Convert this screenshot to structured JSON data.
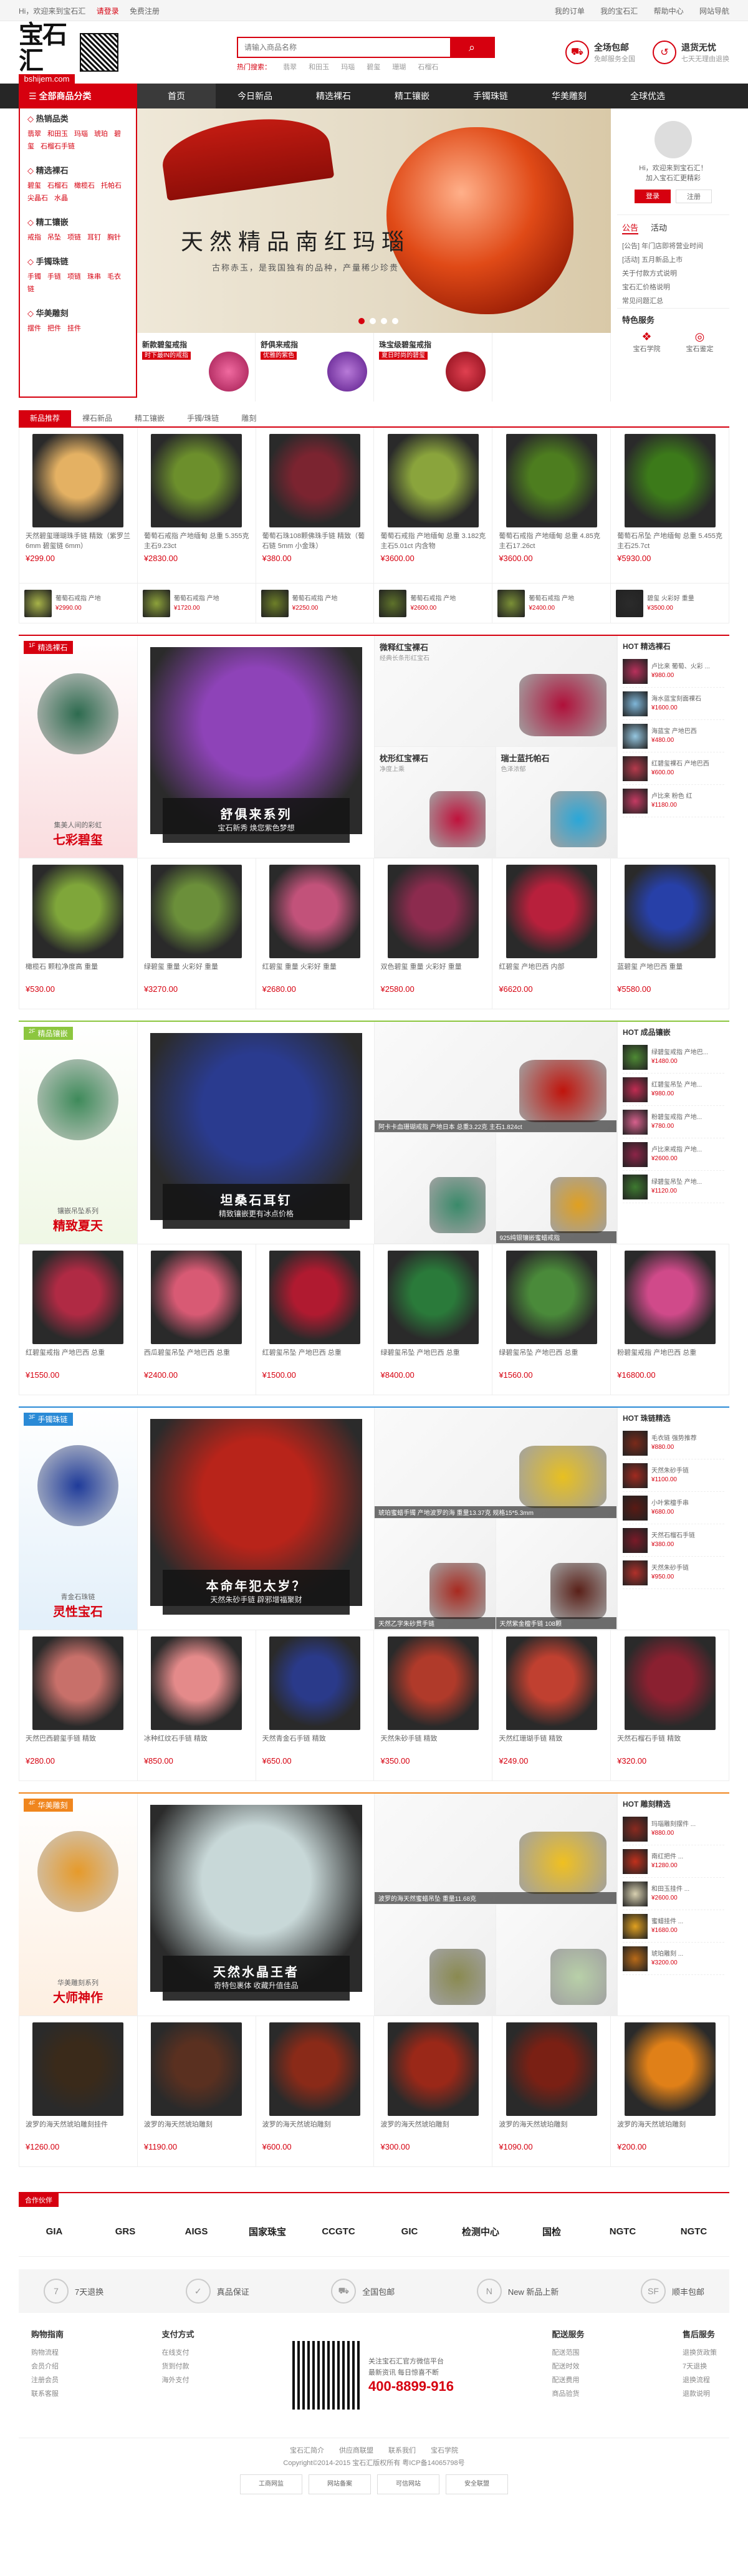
{
  "topbar": {
    "welcome": "Hi，欢迎来到宝石汇",
    "login": "请登录",
    "register": "免费注册",
    "my_orders": "我的订单",
    "my_account": "我的宝石汇",
    "help": "帮助中心",
    "sitemap": "网站导航"
  },
  "header": {
    "logo_text": "宝石汇",
    "logo_url": "bshijem.com",
    "search_placeholder": "请输入商品名称",
    "search_button": "⌕",
    "hot_words": [
      "热门搜索：",
      "翡翠",
      "和田玉",
      "玛瑙",
      "碧玺",
      "珊瑚",
      "石榴石"
    ],
    "promises": [
      {
        "title": "全场包邮",
        "sub": "免邮服务全国"
      },
      {
        "title": "退货无忧",
        "sub": "七天无理由退换"
      }
    ]
  },
  "nav": {
    "all_categories": "全部商品分类",
    "items": [
      "首页",
      "今日新品",
      "精选裸石",
      "精工镶嵌",
      "手镯珠链",
      "华美雕刻",
      "全球优选"
    ]
  },
  "categories": [
    {
      "title": "热销品类",
      "links": [
        "翡翠",
        "和田玉",
        "玛瑙",
        "琥珀",
        "碧玺",
        "石榴石手链"
      ]
    },
    {
      "title": "精选裸石",
      "links": [
        "碧玺",
        "石榴石",
        "橄榄石",
        "托帕石",
        "尖晶石",
        "水晶"
      ]
    },
    {
      "title": "精工镶嵌",
      "links": [
        "戒指",
        "吊坠",
        "项链",
        "耳钉",
        "胸针"
      ]
    },
    {
      "title": "手镯珠链",
      "links": [
        "手镯",
        "手链",
        "项链",
        "珠串",
        "毛衣链"
      ]
    },
    {
      "title": "华美雕刻",
      "links": [
        "摆件",
        "把件",
        "挂件"
      ]
    }
  ],
  "banner": {
    "headline": "天然精品南红玛瑙",
    "sub": "古称赤玉，是我国独有的品种，产量稀少珍贵"
  },
  "sub_banners": [
    {
      "title": "新款碧玺戒指",
      "tag": "时下最IN的戒指"
    },
    {
      "title": "舒俱来戒指",
      "tag": "优雅的紫色"
    },
    {
      "title": "珠宝级碧玺戒指",
      "tag": "夏日时尚的碧玺"
    }
  ],
  "side": {
    "greeting": "Hi，欢迎来到宝石汇！",
    "greeting2": "加入宝石汇更精彩",
    "login_btn": "登录",
    "register_btn": "注册",
    "tabs": [
      "公告",
      "活动"
    ],
    "news": [
      "[公告] 年门店即将营业时间",
      "[活动] 五月新品上市",
      "关于付款方式说明",
      "宝石汇价格说明",
      "常见问题汇总"
    ],
    "service_title": "特色服务",
    "services": [
      "宝石学院",
      "宝石鉴定"
    ]
  },
  "new_tabs": [
    "新品推荐",
    "裸石新品",
    "精工镶嵌",
    "手镯/珠链",
    "雕刻"
  ],
  "new_products": [
    {
      "title": "天然碧玺珊瑚珠手链 精致（紫罗兰 6mm 碧玺链 6mm）",
      "price": "¥299.00",
      "color": "#e4b163"
    },
    {
      "title": "葡萄石戒指 产地缅甸 总重 5.355克 主石9.23ct",
      "price": "¥2830.00",
      "color": "#6c8f2c"
    },
    {
      "title": "葡萄石珠108颗佛珠手链 精致（葡石链 5mm 小金珠）",
      "price": "¥380.00",
      "color": "#7b2430"
    },
    {
      "title": "葡萄石戒指 产地缅甸 总重 3.182克 主石5.01ct 内含物",
      "price": "¥3600.00",
      "color": "#8aa43c"
    },
    {
      "title": "葡萄石戒指 产地缅甸 总重 4.85克 主石17.26ct",
      "price": "¥3600.00",
      "color": "#4d7d1f"
    },
    {
      "title": "葡萄石吊坠 产地缅甸 总重 5.455克 主石25.7ct",
      "price": "¥5930.00",
      "color": "#3c7a1a"
    }
  ],
  "mini_products": [
    {
      "title": "葡萄石戒指 产地",
      "price": "¥2990.00",
      "color": "#a7b348"
    },
    {
      "title": "葡萄石戒指 产地",
      "price": "¥1720.00",
      "color": "#8ca13a"
    },
    {
      "title": "葡萄石戒指 产地",
      "price": "¥2250.00",
      "color": "#6d7f28"
    },
    {
      "title": "葡萄石戒指 产地",
      "price": "¥2600.00",
      "color": "#5e722a"
    },
    {
      "title": "葡萄石戒指 产地",
      "price": "¥2400.00",
      "color": "#7a8f36"
    },
    {
      "title": "碧玺 火彩好 重量",
      "price": "¥3500.00",
      "color": "#2b2b2b"
    }
  ],
  "floors": [
    {
      "num": "1F",
      "name": "精选裸石",
      "tag_color": "#d6000f",
      "promo_title": "七彩碧玺",
      "promo_sub": "集美人间的彩虹",
      "deco": "#2d6b4f",
      "main_title": "舒俱来系列",
      "main_sub": "宝石新秀 焕您紫色梦想",
      "main_color": "#8e43b8",
      "grid": [
        {
          "title": "微释红宝裸石",
          "sub": "经典长条形红宝石",
          "color": "#b0103a",
          "wide": true
        },
        {
          "title": "枕形红宝裸石",
          "sub": "净度上乘",
          "color": "#c0123c"
        },
        {
          "title": "瑞士蓝托帕石",
          "sub": "色泽浓郁",
          "color": "#2aa7d8"
        }
      ],
      "hot_title": "精选裸石",
      "hot": [
        {
          "t": "卢比来 葡萄、火彩 ...",
          "p": "¥980.00",
          "c": "#b8305b"
        },
        {
          "t": "海水蓝宝刻面裸石",
          "p": "¥1600.00",
          "c": "#7fb6d8"
        },
        {
          "t": "海蓝宝 产地巴西",
          "p": "¥480.00",
          "c": "#95c6e0"
        },
        {
          "t": "红碧玺裸石 产地巴西",
          "p": "¥600.00",
          "c": "#b53a4c"
        },
        {
          "t": "卢比来 粉色 红",
          "p": "¥1180.00",
          "c": "#c43a62"
        }
      ],
      "products": [
        {
          "title": "橄榄石 颗粒净度高 重量",
          "price": "¥530.00",
          "color": "#7fa63a"
        },
        {
          "title": "绿碧玺 重量 火彩好 重量",
          "price": "¥3270.00",
          "color": "#6b8f3a"
        },
        {
          "title": "红碧玺 重量 火彩好 重量",
          "price": "¥2680.00",
          "color": "#c2527a"
        },
        {
          "title": "双色碧玺 重量 火彩好 重量",
          "price": "¥2580.00",
          "color": "#8c2b4e"
        },
        {
          "title": "红碧玺 产地巴西 内部",
          "price": "¥6620.00",
          "color": "#b8203c"
        },
        {
          "title": "蓝碧玺 产地巴西 重量",
          "price": "¥5580.00",
          "color": "#2740a8"
        }
      ]
    },
    {
      "num": "2F",
      "name": "精品镶嵌",
      "tag_color": "#8cc63f",
      "promo_title": "精致夏天",
      "promo_sub": "镶嵌吊坠系列",
      "deco": "#3e8a5a",
      "main_title": "坦桑石耳钉",
      "main_sub": "精致镶嵌更有冰点价格",
      "main_color": "#2a3b8f",
      "grid": [
        {
          "title": "",
          "sub": "阿卡卡血珊瑚戒指 产地日本 总重3.22克 主石1.824ct",
          "color": "#c0140c",
          "wide": true
        },
        {
          "title": "",
          "sub": "",
          "color": "#3a8a6a"
        },
        {
          "title": "",
          "sub": "925纯银镶嵌蜜蜡戒指",
          "color": "#e0a020"
        }
      ],
      "hot_title": "成品镶嵌",
      "hot": [
        {
          "t": "绿碧玺戒指 产地巴...",
          "p": "¥1480.00",
          "c": "#4e8a34"
        },
        {
          "t": "红碧玺吊坠 产地...",
          "p": "¥980.00",
          "c": "#c02c52"
        },
        {
          "t": "粉碧玺戒指 产地...",
          "p": "¥780.00",
          "c": "#d6608c"
        },
        {
          "t": "卢比来戒指 产地...",
          "p": "¥2600.00",
          "c": "#8c2448"
        },
        {
          "t": "绿碧玺吊坠 产地...",
          "p": "¥1120.00",
          "c": "#3e7a30"
        }
      ],
      "products": [
        {
          "title": "红碧玺戒指 产地巴西 总重",
          "price": "¥1550.00",
          "color": "#b02a44"
        },
        {
          "title": "西瓜碧玺吊坠 产地巴西 总重",
          "price": "¥2400.00",
          "color": "#d85a74"
        },
        {
          "title": "红碧玺吊坠 产地巴西 总重",
          "price": "¥1500.00",
          "color": "#b01a30"
        },
        {
          "title": "绿碧玺吊坠 产地巴西 总重",
          "price": "¥8400.00",
          "color": "#2a7a3a"
        },
        {
          "title": "绿碧玺吊坠 产地巴西 总重",
          "price": "¥1560.00",
          "color": "#4a8a3a"
        },
        {
          "title": "粉碧玺戒指 产地巴西 总重",
          "price": "¥16800.00",
          "color": "#d04a8a"
        }
      ]
    },
    {
      "num": "3F",
      "name": "手镯珠链",
      "tag_color": "#2a8ad6",
      "promo_title": "灵性宝石",
      "promo_sub": "青金石珠链",
      "deco": "#1f3b9a",
      "main_title": "本命年犯太岁？",
      "main_sub": "天然朱砂手链 辟邪增福聚财",
      "main_color": "#b8241a",
      "grid": [
        {
          "title": "",
          "sub": "琥珀蜜蜡手镯 产地波罗的海 重量13.37克 规格15*5.3mm",
          "color": "#e8c020",
          "wide": true
        },
        {
          "title": "",
          "sub": "天然乙字朱砂贯手链",
          "color": "#a82a20"
        },
        {
          "title": "",
          "sub": "天然紫金檀手链 108颗",
          "color": "#5a2018"
        }
      ],
      "hot_title": "珠链精选",
      "hot": [
        {
          "t": "毛衣链 强势推荐",
          "p": "¥880.00",
          "c": "#7a2a1a"
        },
        {
          "t": "天然朱砂手链",
          "p": "¥1100.00",
          "c": "#a02a20"
        },
        {
          "t": "小叶紫檀手串",
          "p": "¥680.00",
          "c": "#5a1a14"
        },
        {
          "t": "天然石榴石手链",
          "p": "¥380.00",
          "c": "#7a1a28"
        },
        {
          "t": "天然朱砂手链",
          "p": "¥950.00",
          "c": "#b0302a"
        }
      ],
      "products": [
        {
          "title": "天然巴西碧玺手链 精致",
          "price": "¥280.00",
          "color": "#c8706a"
        },
        {
          "title": "冰种红纹石手链 精致",
          "price": "¥850.00",
          "color": "#e48a8a"
        },
        {
          "title": "天然青金石手链 精致",
          "price": "¥650.00",
          "color": "#2a3a8a"
        },
        {
          "title": "天然朱砂手链 精致",
          "price": "¥350.00",
          "color": "#b03a2a"
        },
        {
          "title": "天然红珊瑚手链 精致",
          "price": "¥249.00",
          "color": "#c04030"
        },
        {
          "title": "天然石榴石手链 精致",
          "price": "¥320.00",
          "color": "#8a2030"
        }
      ]
    },
    {
      "num": "4F",
      "name": "华美雕刻",
      "tag_color": "#f0861e",
      "promo_title": "大师神作",
      "promo_sub": "华美雕刻系列",
      "deco": "#e69a2a",
      "main_title": "天然水晶王者",
      "main_sub": "奇特包裹体 收藏升值佳品",
      "main_color": "#c8d8d8",
      "grid": [
        {
          "title": "",
          "sub": "波罗的海天然蜜蜡吊坠 重量11.68克",
          "color": "#f0c020",
          "wide": true
        },
        {
          "title": "",
          "sub": "",
          "color": "#8a8a50"
        },
        {
          "title": "",
          "sub": "",
          "color": "#b8d0a8"
        }
      ],
      "hot_title": "雕刻精选",
      "hot": [
        {
          "t": "玛瑙雕刻摆件 ...",
          "p": "¥880.00",
          "c": "#8a2a20"
        },
        {
          "t": "南红把件 ...",
          "p": "¥1280.00",
          "c": "#c0301c"
        },
        {
          "t": "和田玉挂件 ...",
          "p": "¥2600.00",
          "c": "#d8d0b0"
        },
        {
          "t": "蜜蜡挂件 ...",
          "p": "¥1680.00",
          "c": "#e0a020"
        },
        {
          "t": "琥珀雕刻 ...",
          "p": "¥3200.00",
          "c": "#b86a18"
        }
      ],
      "products": [
        {
          "title": "波罗的海天然琥珀雕刻挂件",
          "price": "¥1260.00",
          "color": "#3a2a1a"
        },
        {
          "title": "波罗的海天然琥珀雕刻",
          "price": "¥1190.00",
          "color": "#5a3020"
        },
        {
          "title": "波罗的海天然琥珀雕刻",
          "price": "¥600.00",
          "color": "#8a2a18"
        },
        {
          "title": "波罗的海天然琥珀雕刻",
          "price": "¥300.00",
          "color": "#9a2818"
        },
        {
          "title": "波罗的海天然琥珀雕刻",
          "price": "¥1090.00",
          "color": "#7a2014"
        },
        {
          "title": "波罗的海天然琥珀雕刻",
          "price": "¥200.00",
          "color": "#e08018"
        }
      ]
    }
  ],
  "partners": {
    "title": "合作伙伴",
    "logos": [
      "GIA",
      "GRS",
      "AIGS",
      "国家珠宝",
      "CCGTC",
      "GIC",
      "检测中心",
      "国检",
      "NGTC",
      "NGTC"
    ]
  },
  "services_bar": [
    "7天退换",
    "真品保证",
    "全国包邮",
    "New 新品上新",
    "顺丰包邮"
  ],
  "footer": {
    "cols": [
      {
        "title": "购物指南",
        "items": [
          "购物流程",
          "会员介绍",
          "注册会员",
          "联系客服"
        ]
      },
      {
        "title": "支付方式",
        "items": [
          "在线支付",
          "货到付款",
          "海外支付"
        ]
      },
      {
        "title": "配送服务",
        "items": [
          "配送范围",
          "配送时效",
          "配送费用",
          "商品验货"
        ]
      },
      {
        "title": "售后服务",
        "items": [
          "退换货政策",
          "7天退换",
          "退换流程",
          "退款说明"
        ]
      }
    ],
    "follow": "关注宝石汇官方微信平台",
    "follow_sub": "最新资讯 每日惊喜不断",
    "tel": "400-8899-916",
    "links": [
      "宝石汇简介",
      "供应商联盟",
      "联系我们",
      "宝石学院"
    ],
    "copyright": "Copyright©2014-2015 宝石汇版权所有 粤ICP备14065798号",
    "badges": [
      "工商网监",
      "网站备案",
      "可信网站",
      "安全联盟"
    ]
  }
}
